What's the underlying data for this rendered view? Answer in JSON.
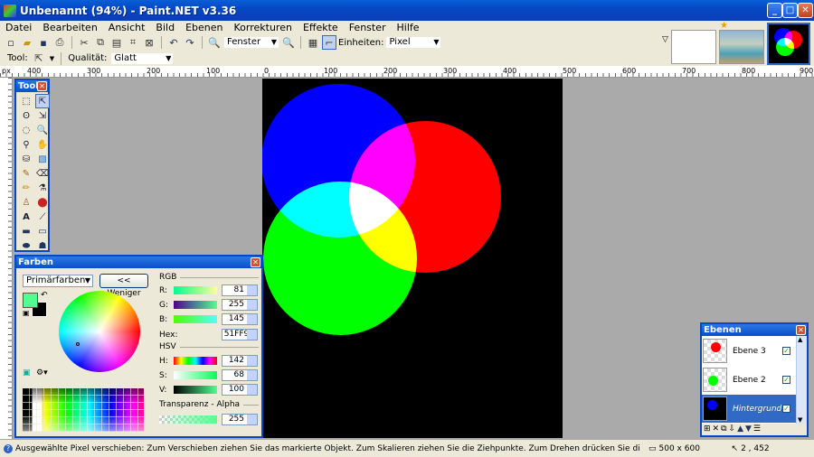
{
  "window": {
    "title": "Unbenannt (94%) - Paint.NET v3.36",
    "minimize": "_",
    "maximize": "□",
    "close": "✕"
  },
  "menu": [
    "Datei",
    "Bearbeiten",
    "Ansicht",
    "Bild",
    "Ebenen",
    "Korrekturen",
    "Effekte",
    "Fenster",
    "Hilfe"
  ],
  "toolbar": {
    "zoom_value": "Fenster",
    "units_label": "Einheiten:",
    "units_value": "Pixel"
  },
  "toolbar2": {
    "tool_label": "Tool:",
    "quality_label": "Qualität:",
    "quality_value": "Glatt"
  },
  "ruler": {
    "unit": "px",
    "ticks": [
      "400",
      "300",
      "200",
      "100",
      "0",
      "100",
      "200",
      "300",
      "400",
      "500",
      "600",
      "700",
      "800",
      "900"
    ]
  },
  "tools_panel": {
    "title": "Tools"
  },
  "colors_panel": {
    "title": "Farben",
    "mode": "Primärfarben",
    "less_button": "<< Weniger",
    "rgb_heading": "RGB",
    "r_label": "R:",
    "r_value": "81",
    "g_label": "G:",
    "g_value": "255",
    "b_label": "B:",
    "b_value": "145",
    "hex_label": "Hex:",
    "hex_value": "51FF91",
    "hsv_heading": "HSV",
    "h_label": "H:",
    "h_value": "142",
    "s_label": "S:",
    "s_value": "68",
    "v_label": "V:",
    "v_value": "100",
    "alpha_label": "Transparenz - Alpha",
    "alpha_value": "255",
    "primary_color": "#51FF91",
    "secondary_color": "#000000"
  },
  "layers_panel": {
    "title": "Ebenen",
    "layers": [
      {
        "name": "Ebene 3",
        "visible": true
      },
      {
        "name": "Ebene 2",
        "visible": true
      },
      {
        "name": "Hintergrund",
        "visible": true,
        "selected": true
      }
    ]
  },
  "status": {
    "message": "Ausgewählte Pixel verschieben: Zum Verschieben ziehen Sie das markierte Objekt. Zum Skalieren ziehen Sie die Ziehpunkte. Zum Drehen drücken Sie die RMT und ziehen Sie das Objekt.",
    "size": "500 x 600",
    "position": "2 , 452"
  },
  "canvas": {
    "background": "#000000",
    "circles": [
      "#0000ff",
      "#ff0000",
      "#00ff00"
    ]
  }
}
